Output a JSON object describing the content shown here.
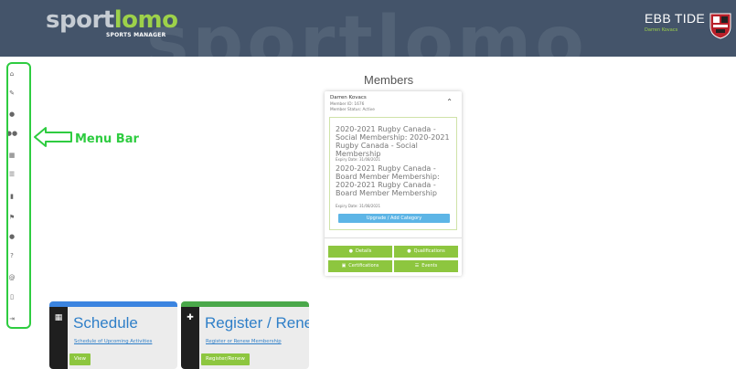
{
  "header": {
    "logo": {
      "part1": "sport",
      "part2": "lomo",
      "subtitle": "SPORTS MANAGER"
    },
    "watermark_text": "sportlomo",
    "club_name": "EBB TIDE",
    "user_name": "Darren Kovacs",
    "colors": {
      "header_bg": "#44546a",
      "accent_green": "#9dd14a"
    }
  },
  "sidebar": {
    "items": [
      {
        "icon": "home-icon",
        "glyph": "⌂"
      },
      {
        "icon": "edit-icon",
        "glyph": "✎"
      },
      {
        "icon": "user-icon",
        "glyph": "●"
      },
      {
        "icon": "users-icon",
        "glyph": "●●"
      },
      {
        "icon": "calendar-icon",
        "glyph": "▦"
      },
      {
        "icon": "list-icon",
        "glyph": "☰"
      },
      {
        "icon": "trash-icon",
        "glyph": "▮"
      },
      {
        "icon": "flag-icon",
        "glyph": "⚑"
      },
      {
        "icon": "profile-icon",
        "glyph": "●"
      },
      {
        "icon": "help-icon",
        "glyph": "?"
      },
      {
        "icon": "at-icon",
        "glyph": "@"
      },
      {
        "icon": "document-icon",
        "glyph": "▯"
      },
      {
        "icon": "logout-icon",
        "glyph": "⇥"
      }
    ]
  },
  "annotation": {
    "label": "Menu Bar",
    "color": "#2ecc40"
  },
  "members": {
    "title": "Members",
    "name": "Darren Kovacs",
    "member_id": "Member ID: 1676",
    "status": "Member Status: Active",
    "memberships": [
      {
        "text": "2020-2021 Rugby Canada - Social Membership: 2020-2021 Rugby Canada - Social Membership",
        "expiry": "Expiry Date: 31/08/2021"
      },
      {
        "text": "2020-2021 Rugby Canada - Board Member Membership: 2020-2021 Rugby Canada - Board Member Membership",
        "expiry": "Expiry Date: 31/08/2021"
      }
    ],
    "upgrade_label": "Upgrade / Add Category",
    "buttons": {
      "details": "Details",
      "qualifications": "Qualifications",
      "certifications": "Certifications",
      "events": "Events"
    }
  },
  "tiles": [
    {
      "title": "Schedule",
      "link": "Schedule of Upcoming Activities",
      "button": "View",
      "accent": "#3b84e0",
      "icon": "calendar-icon"
    },
    {
      "title": "Register / Renew",
      "link": "Register or Renew Membership",
      "button": "Register/Renew",
      "accent": "#4aa84a",
      "icon": "user-add-icon"
    }
  ]
}
